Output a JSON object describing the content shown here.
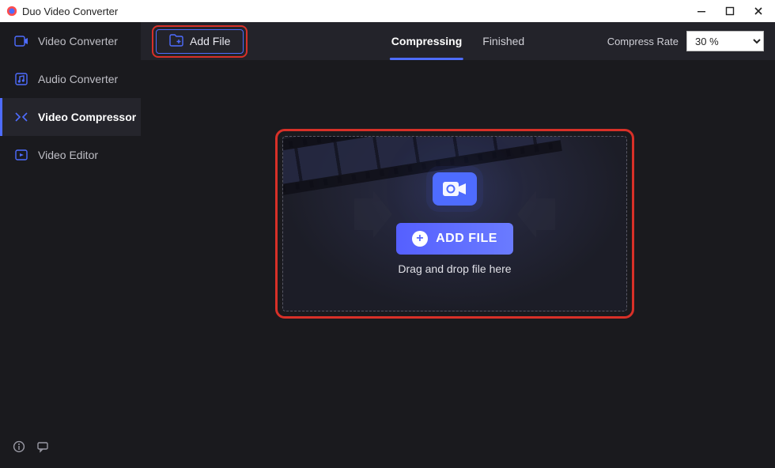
{
  "window": {
    "title": "Duo Video Converter"
  },
  "sidebar": {
    "items": [
      {
        "label": "Video Converter"
      },
      {
        "label": "Audio Converter"
      },
      {
        "label": "Video Compressor"
      },
      {
        "label": "Video Editor"
      }
    ],
    "active_index": 2
  },
  "toolbar": {
    "add_file_label": "Add File",
    "tabs": [
      {
        "label": "Compressing"
      },
      {
        "label": "Finished"
      }
    ],
    "active_tab_index": 0,
    "compress_rate_label": "Compress Rate",
    "compress_rate_value": "30 %"
  },
  "dropzone": {
    "add_file_label": "ADD FILE",
    "hint": "Drag and drop file here"
  },
  "highlights": {
    "add_file_button": true,
    "dropzone": true,
    "color": "#d83028"
  }
}
